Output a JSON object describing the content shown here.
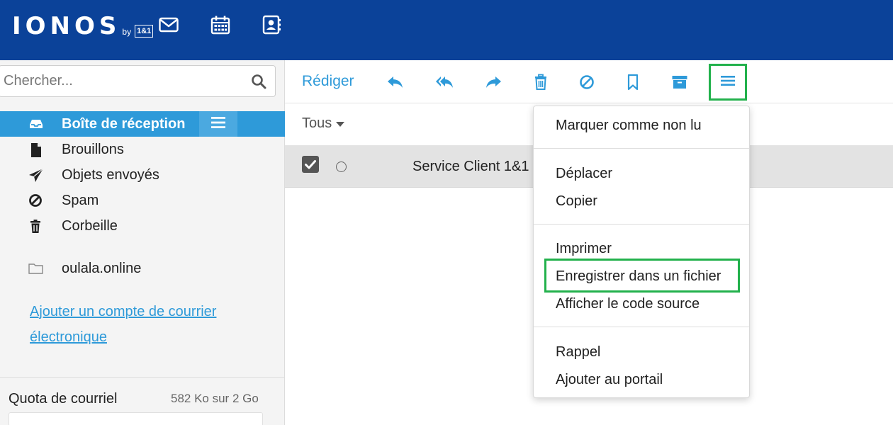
{
  "header": {
    "logo_text": "IONOS",
    "logo_by": "by",
    "logo_brand": "1&1",
    "nav_icons": [
      "mail-icon",
      "calendar-icon",
      "contacts-icon"
    ],
    "bg_color": "#0b4299"
  },
  "search": {
    "placeholder": "Chercher..."
  },
  "sidebar": {
    "folders": [
      {
        "label": "Boîte de réception",
        "icon": "inbox-icon",
        "active": true
      },
      {
        "label": "Brouillons",
        "icon": "file-icon"
      },
      {
        "label": "Objets envoyés",
        "icon": "paper-plane-icon"
      },
      {
        "label": "Spam",
        "icon": "ban-icon"
      },
      {
        "label": "Corbeille",
        "icon": "trash-icon"
      }
    ],
    "account": {
      "label": "oulala.online",
      "icon": "folder-icon"
    },
    "add_account_label": "Ajouter un compte de courrier électronique",
    "quota_label": "Quota de courriel",
    "quota_value": "582 Ko sur 2 Go",
    "active_color": "#2e9ad9"
  },
  "toolbar": {
    "compose_label": "Rédiger",
    "icons": [
      "reply-icon",
      "reply-all-icon",
      "forward-icon",
      "trash-icon",
      "ban-icon",
      "bookmark-icon",
      "archive-icon",
      "menu-icon"
    ],
    "accent_color": "#2e9ad9"
  },
  "list": {
    "filter_label": "Tous",
    "rows": [
      {
        "sender": "Service Client 1&1 I",
        "checked": true
      }
    ]
  },
  "menu": {
    "items": [
      {
        "label": "Marquer comme non lu"
      },
      {
        "label": "Déplacer"
      },
      {
        "label": "Copier"
      },
      {
        "label": "Imprimer"
      },
      {
        "label": "Enregistrer dans un fichier",
        "highlighted": true
      },
      {
        "label": "Afficher le code source"
      },
      {
        "label": "Rappel"
      },
      {
        "label": "Ajouter au portail"
      }
    ],
    "highlight_color": "#22b14c"
  }
}
